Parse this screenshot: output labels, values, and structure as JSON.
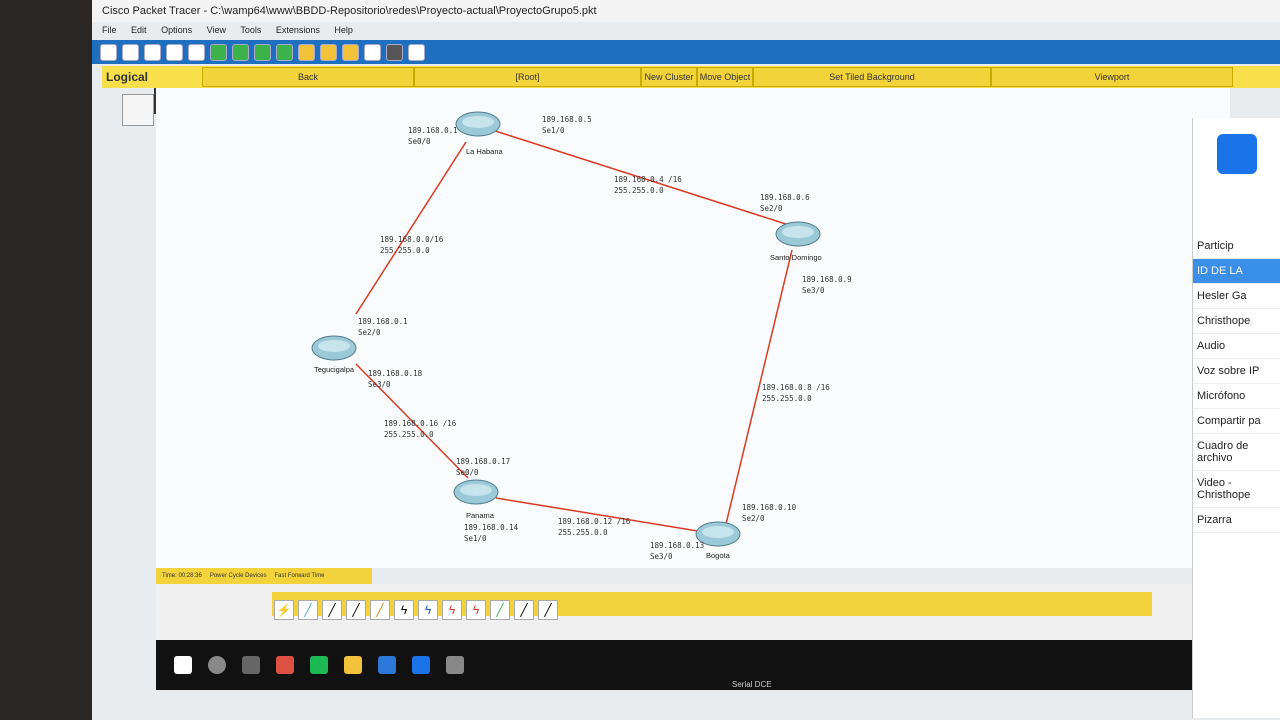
{
  "window": {
    "title": "Cisco Packet Tracer - C:\\wamp64\\www\\BBDD-Repositorio\\redes\\Proyecto-actual\\ProyectoGrupo5.pkt"
  },
  "menu": [
    "File",
    "Edit",
    "Options",
    "View",
    "Tools",
    "Extensions",
    "Help"
  ],
  "logical_bar": {
    "logical_label": "Logical",
    "back": "Back",
    "root": "[Root]",
    "new_cluster": "New Cluster",
    "move_object": "Move Object",
    "set_background": "Set Tiled Background",
    "viewport": "Viewport"
  },
  "routers": [
    {
      "name": "La Habana"
    },
    {
      "name": "Santo Domingo"
    },
    {
      "name": "Tegucigalpa"
    },
    {
      "name": "Panama"
    },
    {
      "name": "Bogota"
    }
  ],
  "labels": {
    "hab_ip1": "189.168.0.1",
    "hab_if1": "Se0/0",
    "hab_ip2": "189.168.0.5",
    "hab_if2": "Se1/0",
    "net1_a": "189.168.0.4 /16",
    "net1_b": "255.255.0.0",
    "sd_ip1": "189.168.0.6",
    "sd_if1": "Se2/0",
    "sd_ip2": "189.168.0.9",
    "sd_if2": "Se3/0",
    "net2_a": "189.168.0.0/16",
    "net2_b": "255.255.0.0",
    "teg_ip1": "189.168.0.1",
    "teg_if1": "Se2/0",
    "teg_ip2": "189.168.0.18",
    "teg_if2": "Se3/0",
    "net3_a": "189.168.0.8 /16",
    "net3_b": "255.255.0.0",
    "net4_a": "189.168.0.16 /16",
    "net4_b": "255.255.0.0",
    "pan_ip1": "189.168.0.17",
    "pan_if1": "Se0/0",
    "pan_ip2": "189.168.0.14",
    "pan_if2": "Se1/0",
    "net5_a": "189.168.0.12 /16",
    "net5_b": "255.255.0.0",
    "bog_ip1": "189.168.0.10",
    "bog_if1": "Se2/0",
    "bog_ip2": "189.168.0.13",
    "bog_if2": "Se3/0"
  },
  "bottom": {
    "time": "Time: 00:28:36",
    "power": "Power Cycle Devices",
    "fast": "Fast Forward Time",
    "status": "Serial DCE"
  },
  "side_panel": {
    "participants": "Particip",
    "id_label": "ID DE LA",
    "p1": "Hesler Ga",
    "p2": "Christhope",
    "audio": "Audio",
    "voice": "Voz sobre IP",
    "mic": "Micrófono",
    "share": "Compartir pa",
    "files": "Cuadro de archivo",
    "video": "Video - Christhope",
    "board": "Pizarra"
  },
  "colors": {
    "link": "#d83a22",
    "toolbar": "#1f6fc0",
    "yellow": "#f2d33c"
  }
}
